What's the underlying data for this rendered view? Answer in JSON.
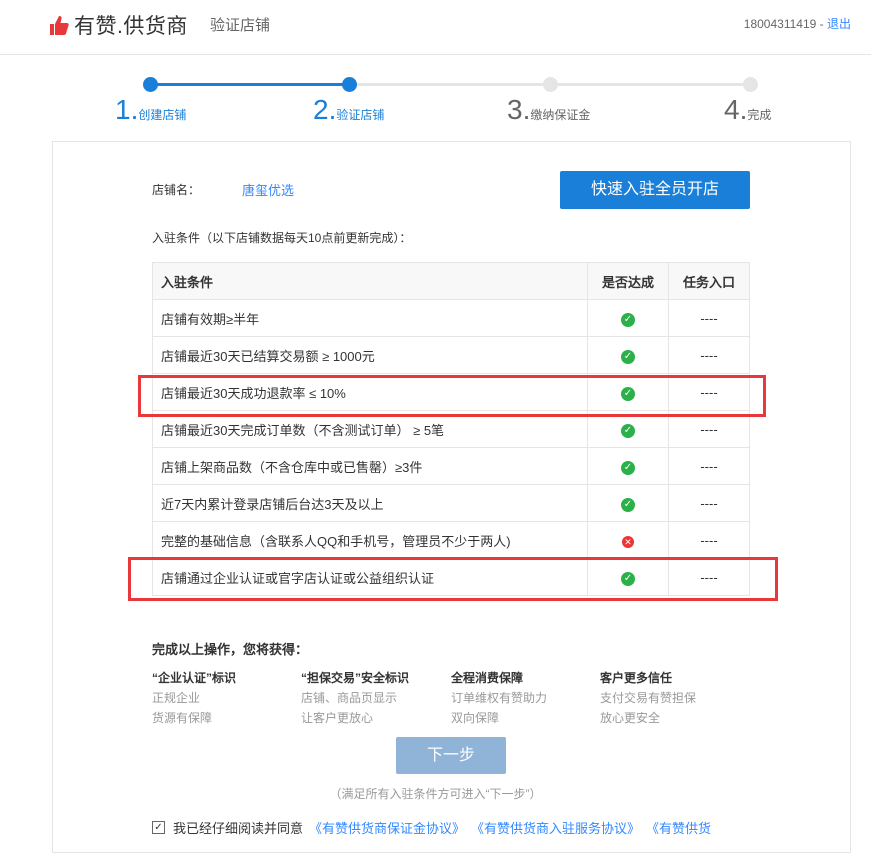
{
  "header": {
    "brand": "有赞.供货商",
    "subtitle": "验证店铺",
    "account": "18004311419",
    "separator": " - ",
    "logout": "退出",
    "brand_color": "#e8383b"
  },
  "steps": [
    {
      "num": "1.",
      "label": "创建店铺",
      "state": "done"
    },
    {
      "num": "2.",
      "label": "验证店铺",
      "state": "active"
    },
    {
      "num": "3.",
      "label": "缴纳保证金",
      "state": "todo"
    },
    {
      "num": "4.",
      "label": "完成",
      "state": "todo"
    }
  ],
  "shop": {
    "label": "店铺名：",
    "name": "唐玺优选",
    "fast_button": "快速入驻全员开店"
  },
  "conditions": {
    "note": "入驻条件（以下店铺数据每天10点前更新完成）：",
    "headers": [
      "入驻条件",
      "是否达成",
      "任务入口"
    ],
    "rows": [
      {
        "text": "店铺有效期≥半年",
        "status": "ok",
        "entry": "----"
      },
      {
        "text": "店铺最近30天已结算交易额 ≥ 1000元",
        "status": "ok",
        "entry": "----"
      },
      {
        "text": "店铺最近30天成功退款率 ≤ 10%",
        "status": "ok",
        "entry": "----"
      },
      {
        "text": "店铺最近30天完成订单数（不含测试订单） ≥ 5笔",
        "status": "ok",
        "entry": "----"
      },
      {
        "text": "店铺上架商品数（不含仓库中或已售罄）≥3件",
        "status": "ok",
        "entry": "----"
      },
      {
        "text": "近7天内累计登录店铺后台达3天及以上",
        "status": "ok",
        "entry": "----"
      },
      {
        "text": "完整的基础信息（含联系人QQ和手机号，管理员不少于两人)",
        "status": "fail",
        "entry": "----"
      },
      {
        "text": "店铺通过企业认证或官字店认证或公益组织认证",
        "status": "ok",
        "entry": "----"
      }
    ]
  },
  "benefits": {
    "title": "完成以上操作，您将获得：",
    "items": [
      {
        "title": "“企业认证”标识",
        "lines": [
          "正规企业",
          "货源有保障"
        ]
      },
      {
        "title": "“担保交易”安全标识",
        "lines": [
          "店铺、商品页显示",
          "让客户更放心"
        ]
      },
      {
        "title": "全程消费保障",
        "lines": [
          "订单维权有赞助力",
          "双向保障"
        ]
      },
      {
        "title": "客户更多信任",
        "lines": [
          "支付交易有赞担保",
          "放心更安全"
        ]
      }
    ]
  },
  "next": {
    "button": "下一步",
    "note": "（满足所有入驻条件方可进入“下一步”）"
  },
  "agreement": {
    "text": "我已经仔细阅读并同意",
    "links": [
      "《有赞供货商保证金协议》",
      "《有赞供货商入驻服务协议》",
      "《有赞供货"
    ]
  }
}
